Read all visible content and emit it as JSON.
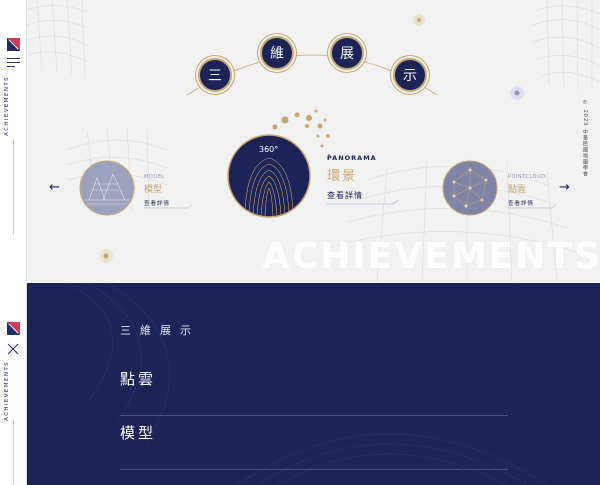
{
  "sidebar": {
    "vertical_label": "ACHIEVEMENTS"
  },
  "hero": {
    "title_chars": [
      "三",
      "維",
      "展",
      "示"
    ],
    "prev_arrow": "←",
    "next_arrow": "→",
    "center": {
      "badge": "360°",
      "en": "PANORAMA",
      "zh": "環景",
      "link": "查看詳情"
    },
    "left": {
      "en": "MODEL",
      "zh": "模型",
      "link": "查看詳情"
    },
    "right": {
      "en": "POINTCLOUD",
      "zh": "點雲",
      "link": "查看詳情"
    },
    "watermark": "ACHIEVEMENTS",
    "copyright": "© 2023 中華民國地圖學會"
  },
  "menu": {
    "heading": "三維展示",
    "items": [
      {
        "label": "點雲"
      },
      {
        "label": "模型"
      }
    ]
  },
  "colors": {
    "navy": "#1c2357",
    "gold": "#c7a870",
    "panel": "#f1f1f1"
  }
}
